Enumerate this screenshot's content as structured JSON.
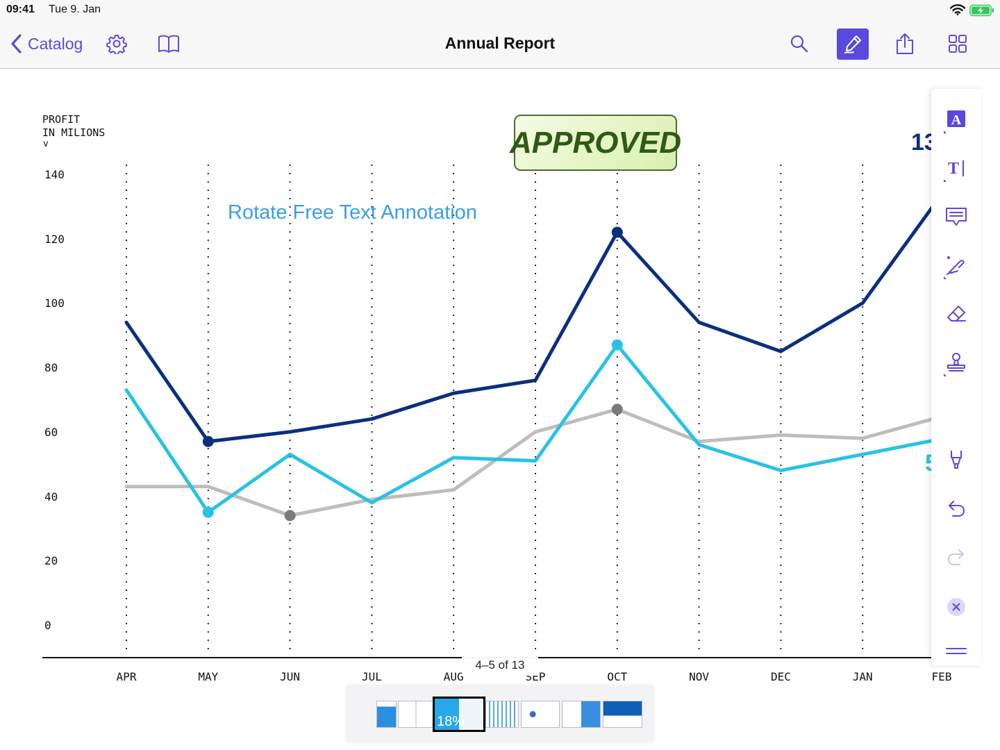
{
  "status_bar": {
    "time": "09:41",
    "date": "Tue 9. Jan"
  },
  "nav": {
    "back_label": "Catalog",
    "title": "Annual Report",
    "accent": "#5a48df"
  },
  "annotations": {
    "free_text": "Rotate Free Text Annotation",
    "stamp_text": "APPROVED",
    "edge_label_top": "13",
    "edge_label_low": "5"
  },
  "toolbar": {
    "tools": [
      "text-highlight-icon",
      "free-text-icon",
      "note-icon",
      "signature-icon",
      "eraser-icon",
      "stamp-icon",
      "highlighter-icon",
      "undo-icon",
      "redo-icon",
      "close-icon",
      "drag-handle-icon"
    ]
  },
  "pager": {
    "indicator": "4–5 of 13",
    "active_thumb_label": "18%"
  },
  "chart_data": {
    "type": "line",
    "ylabel_line1": "PROFIT",
    "ylabel_line2": "IN MILIONS",
    "ylabel_arrow": "v",
    "categories": [
      "APR",
      "MAY",
      "JUN",
      "JUL",
      "AUG",
      "SEP",
      "OCT",
      "NOV",
      "DEC",
      "JAN",
      "FEB"
    ],
    "yticks": [
      "140",
      "120",
      "100",
      "80",
      "60",
      "40",
      "20",
      "0"
    ],
    "ylim": [
      0,
      140
    ],
    "grid": "vertical dotted",
    "series": [
      {
        "color": "#0b2f80",
        "values": [
          94,
          57,
          60,
          64,
          72,
          76,
          122,
          94,
          85,
          100,
          135
        ],
        "markers": [
          1,
          6
        ]
      },
      {
        "color": "#29c2e4",
        "values": [
          73,
          35,
          53,
          38,
          52,
          51,
          87,
          56,
          48,
          53,
          58
        ],
        "markers": [
          1,
          6
        ]
      },
      {
        "color": "#bdbdbd",
        "values": [
          43,
          43,
          34,
          39,
          42,
          60,
          67,
          57,
          59,
          58,
          65
        ],
        "markers": [
          2,
          6
        ]
      }
    ]
  }
}
